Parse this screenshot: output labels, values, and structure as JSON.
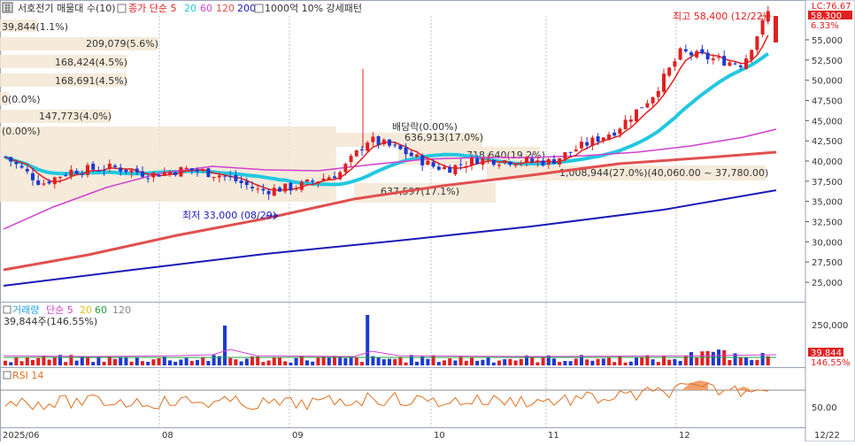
{
  "header": {
    "title": "서호전기 매물대 수(10)",
    "ma_label": "종가 단순 5",
    "ma_periods": [
      "20",
      "60",
      "120",
      "200"
    ],
    "ma_colors": [
      "#e02020",
      "#22c8e0",
      "#d040d0",
      "#e05050",
      "#1a1ab8"
    ],
    "extra": "1000억 10% 강세패턴",
    "corner_value": "LC:76.67",
    "icon": "grid-icon"
  },
  "price_panel": {
    "high_label": "최고 58,400 (12/22)",
    "low_label": "최저 33,000 (08/29)",
    "dividend_label": "배당락(0.00%)",
    "current_price": "58,300",
    "current_change": "6.33%",
    "axis_ticks": [
      "55,000",
      "52,500",
      "50,000",
      "47,500",
      "45,000",
      "42,500",
      "40,000",
      "37,500",
      "35,000",
      "32,500",
      "30,000",
      "27,500",
      "25,000"
    ],
    "volume_profile_labels": [
      "39,844(1.1%)",
      "209,079(5.6%)",
      "168,424(4.5%)",
      "168,691(4.5%)",
      "0(0.0%)",
      "147,773(4.0%)",
      "(0.00%)",
      "636,913(17.0%)",
      "718,640(19.2%)",
      "1,008,944(27.0%)(40,060.00 ~ 37,780.00)",
      "637,597(17.1%)"
    ]
  },
  "volume_panel": {
    "title": "거래량",
    "ma_label": "단순 5",
    "ma_periods": [
      "20",
      "60",
      "120"
    ],
    "current": "39,844주(146.55%)",
    "axis_tick": "250,000",
    "right_value": "39,844",
    "right_percent": "146.55%"
  },
  "rsi_panel": {
    "title": "RSI 14",
    "axis_tick": "50.00"
  },
  "x_axis": {
    "labels": [
      "2025/06",
      "08",
      "09",
      "10",
      "11",
      "12",
      "12/22"
    ]
  }
}
